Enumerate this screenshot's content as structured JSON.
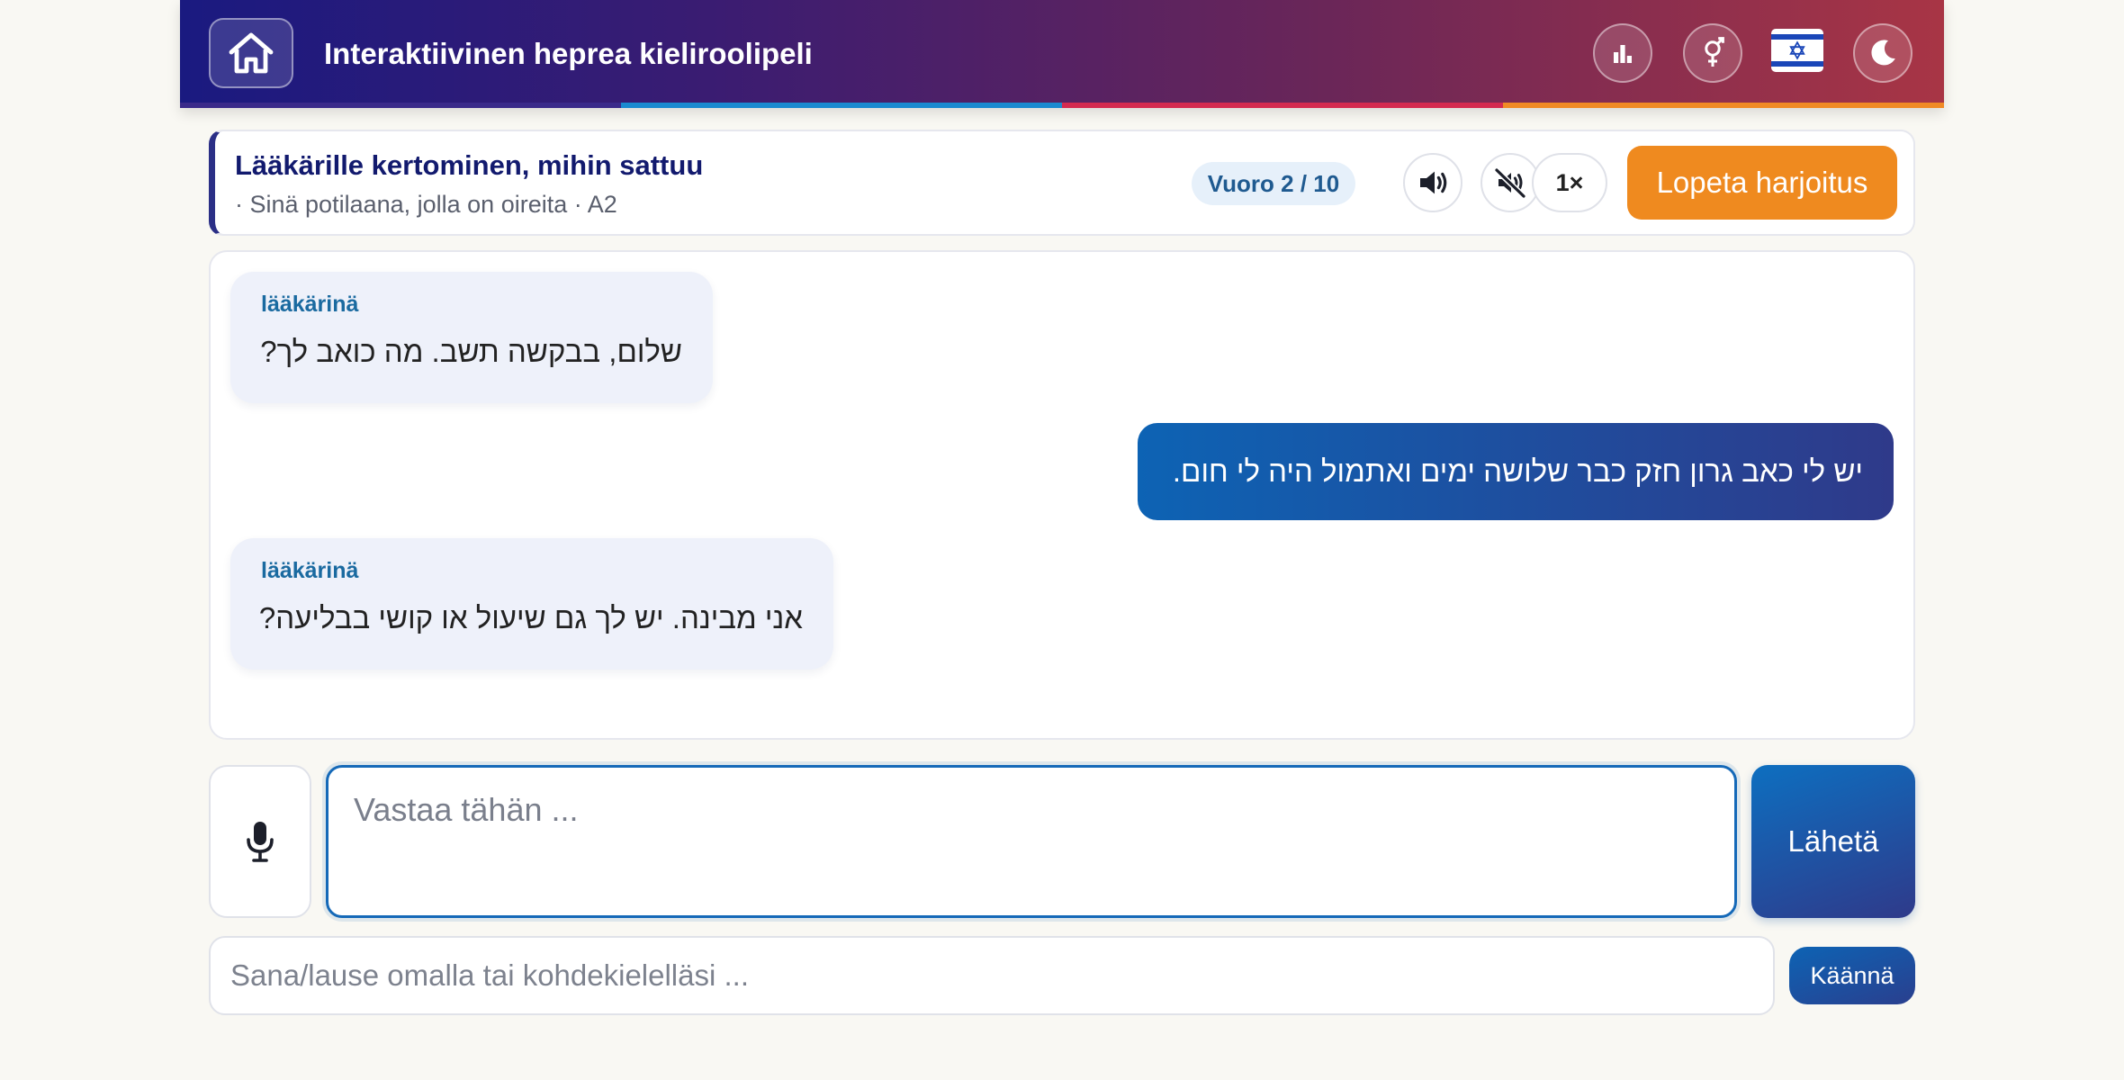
{
  "header": {
    "title": "Interaktiivinen heprea kieliroolipeli",
    "icons": [
      "home-icon",
      "stats-icon",
      "gender-icon",
      "israel-flag-icon",
      "moon-icon"
    ],
    "gradient_start": "#1a1a80",
    "gradient_end": "#a83545",
    "stripe_colors": [
      "#3a2a8a",
      "#1a8ad0",
      "#d42a50",
      "#f08a25"
    ]
  },
  "scenario": {
    "title": "Lääkärille kertominen, mihin sattuu",
    "subtitle": "· Sinä potilaana, jolla on oireita · A2",
    "turn": "Vuoro 2 / 10",
    "speed": "1×",
    "stop_label": "Lopeta harjoitus",
    "stop_color": "#ef8a1f",
    "icons": [
      "speaker-icon",
      "mute-icon"
    ]
  },
  "messages": [
    {
      "role": "partner",
      "label": "lääkärinä",
      "text": "שלום, בבקשה תשב. מה כואב לך?"
    },
    {
      "role": "user",
      "text": "יש לי כאב גרון חזק כבר שלושה ימים ואתמול היה לי חום."
    },
    {
      "role": "partner",
      "label": "lääkärinä",
      "text": "אני מבינה. יש לך גם שיעול או קושי בבליעה?"
    }
  ],
  "input": {
    "placeholder": "Vastaa tähän ...",
    "send_label": "Lähetä",
    "mic_icon": "microphone-icon"
  },
  "translate": {
    "placeholder": "Sana/lause omalla tai kohdekielelläsi ...",
    "button_label": "Käännä"
  }
}
